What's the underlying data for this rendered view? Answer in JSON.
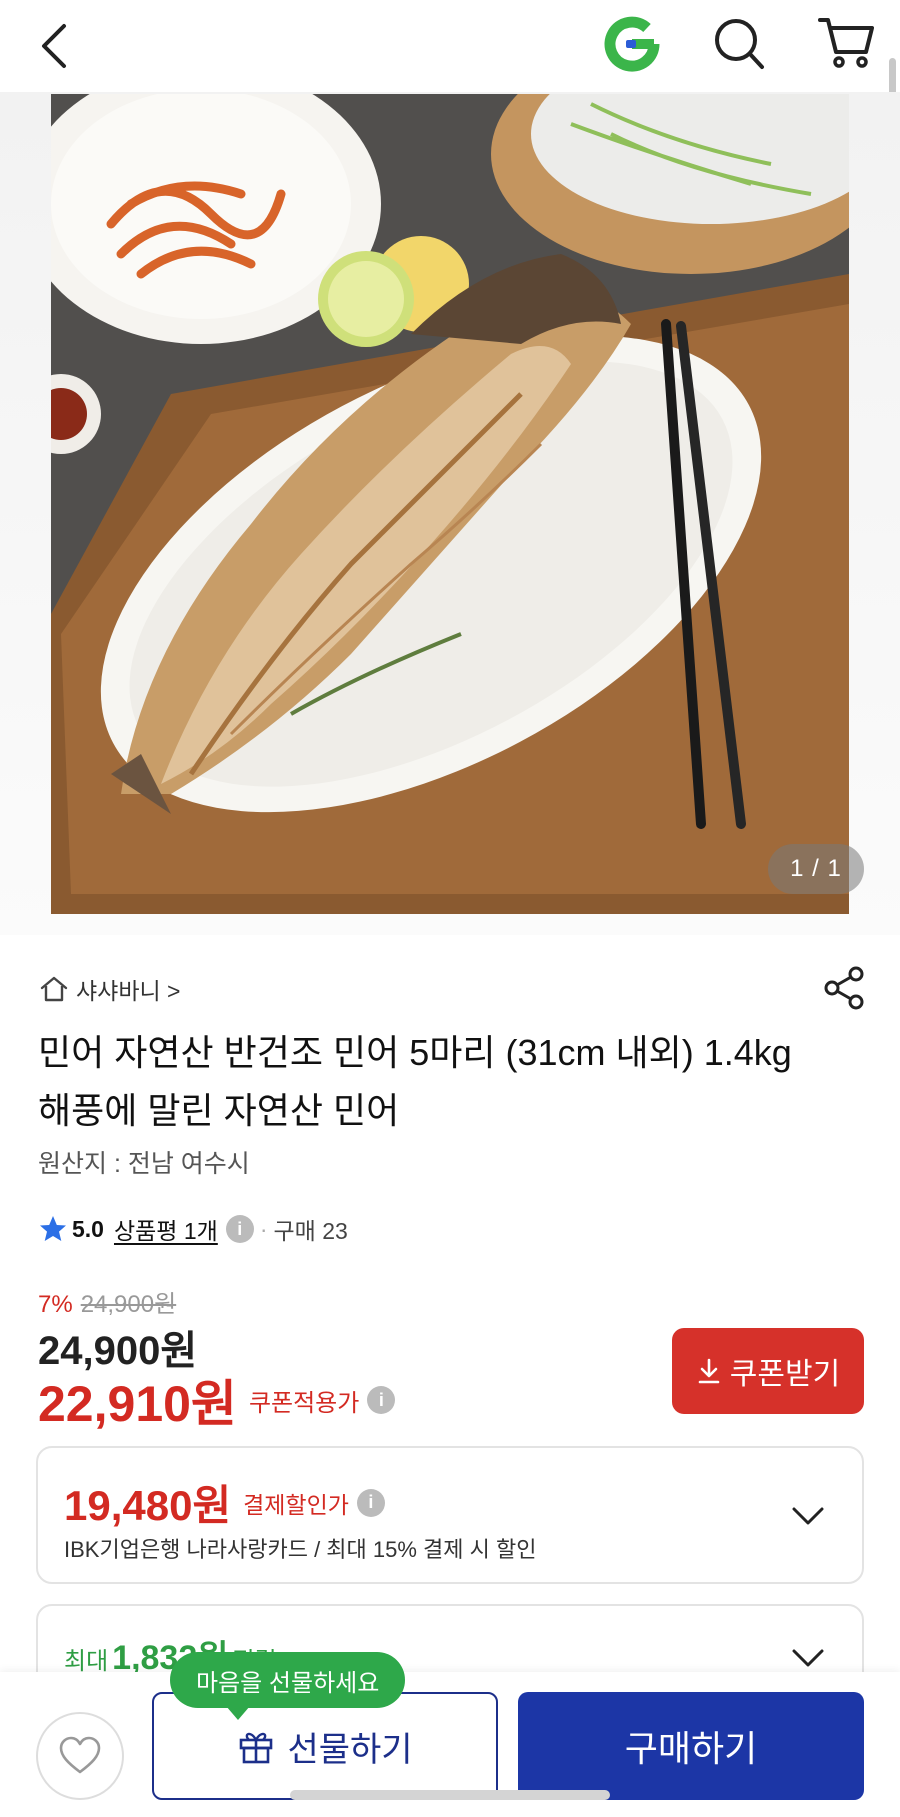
{
  "header": {
    "icons": [
      "back-icon",
      "g-logo-icon",
      "search-icon",
      "cart-icon"
    ]
  },
  "image": {
    "counter": "1 / 1"
  },
  "store": {
    "name": "샤샤바니 >"
  },
  "product": {
    "title": "민어 자연산 반건조 민어 5마리 (31cm 내외) 1.4kg 해풍에 말린 자연산 민어",
    "origin": "원산지 : 전남 여수시"
  },
  "rating": {
    "score": "5.0",
    "reviews": "상품평 1개",
    "info": "i",
    "purchase": "구매 23"
  },
  "pricing": {
    "discount_pct": "7%",
    "original_price": "24,900원",
    "current_price": "24,900원",
    "coupon_price": "22,910원",
    "coupon_label": "쿠폰적용가",
    "coupon_button": "쿠폰받기"
  },
  "card_discount": {
    "amount": "19,480원",
    "label": "결제할인가",
    "description": "IBK기업은행 나라사랑카드 / 최대 15% 결제 시 할인"
  },
  "points": {
    "prefix": "최대",
    "amount": "1,832원",
    "suffix": "적립"
  },
  "bottom": {
    "tooltip": "마음을 선물하세요",
    "gift_label": "선물하기",
    "buy_label": "구매하기"
  },
  "colors": {
    "accent_red": "#d32a22",
    "brand_blue": "#1c36a6",
    "green": "#2ea84a"
  }
}
